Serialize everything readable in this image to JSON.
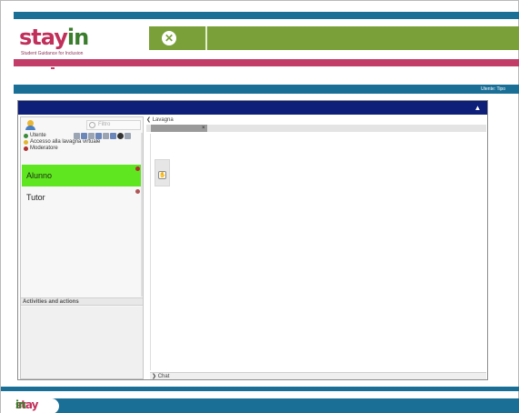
{
  "brand": {
    "logo_main": "stay",
    "logo_in": "in",
    "tagline": "Student Guidance for Inclusion"
  },
  "header": {
    "close_icon": "close-circle-icon",
    "user_label": "Utente: Tipo"
  },
  "users_panel": {
    "filter_placeholder": "Filtro",
    "legend": [
      {
        "label": "Utente",
        "color": "#3a8a3a"
      },
      {
        "label": "Accesso alla lavagna virtuale",
        "color": "#e2b42d"
      },
      {
        "label": "Moderatore",
        "color": "#b03030"
      }
    ],
    "users": [
      {
        "name": "Alunno",
        "selected": true
      },
      {
        "name": "Tutor",
        "selected": false
      }
    ]
  },
  "activities": {
    "title": "Activities and actions"
  },
  "whiteboard": {
    "title": "Lavagna",
    "tab_close": "×"
  },
  "chat": {
    "label": "Chat"
  },
  "footer": {
    "logo_main": "stay",
    "logo_in": "in"
  }
}
